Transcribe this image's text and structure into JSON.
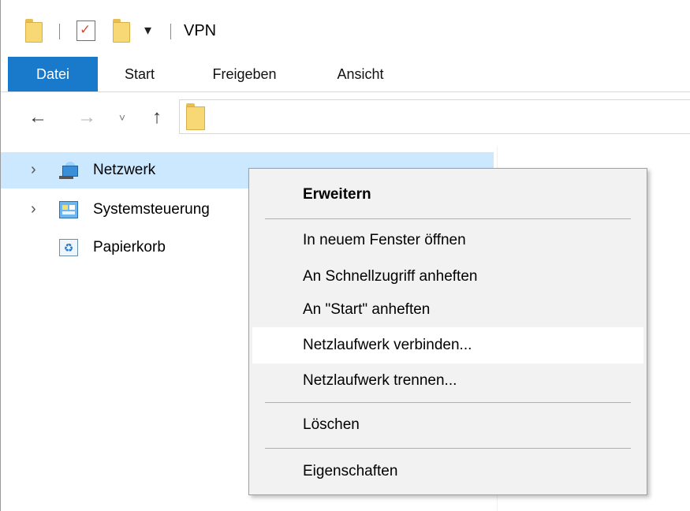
{
  "window": {
    "title": "VPN"
  },
  "ribbon": {
    "tabs": [
      "Datei",
      "Start",
      "Freigeben",
      "Ansicht"
    ]
  },
  "quick_access": {
    "customize_symbol": "▾"
  },
  "nav": {
    "back_icon": "arrow-left-icon",
    "forward_icon": "arrow-right-icon",
    "recent_icon": "chevron-down-icon",
    "up_icon": "arrow-up-icon"
  },
  "address": {
    "value": ""
  },
  "tree": {
    "items": [
      {
        "label": "Netzwerk",
        "icon": "network-icon",
        "expandable": true,
        "selected": true
      },
      {
        "label": "Systemsteuerung",
        "icon": "control-panel-icon",
        "expandable": true,
        "selected": false
      },
      {
        "label": "Papierkorb",
        "icon": "recycle-bin-icon",
        "expandable": false,
        "selected": false
      }
    ]
  },
  "context_menu": {
    "items": [
      {
        "label": "Erweitern",
        "bold": true
      },
      {
        "label": "In neuem Fenster öffnen"
      },
      {
        "label": "An Schnellzugriff anheften"
      },
      {
        "label": "An \"Start\" anheften"
      },
      {
        "label": "Netzlaufwerk verbinden...",
        "highlighted": true
      },
      {
        "label": "Netzlaufwerk trennen..."
      },
      {
        "label": "Löschen"
      },
      {
        "label": "Eigenschaften"
      }
    ]
  },
  "colors": {
    "accent": "#1979ca",
    "selection": "#cce8ff",
    "folder": "#f8d775",
    "menu_bg": "#f2f2f2"
  }
}
